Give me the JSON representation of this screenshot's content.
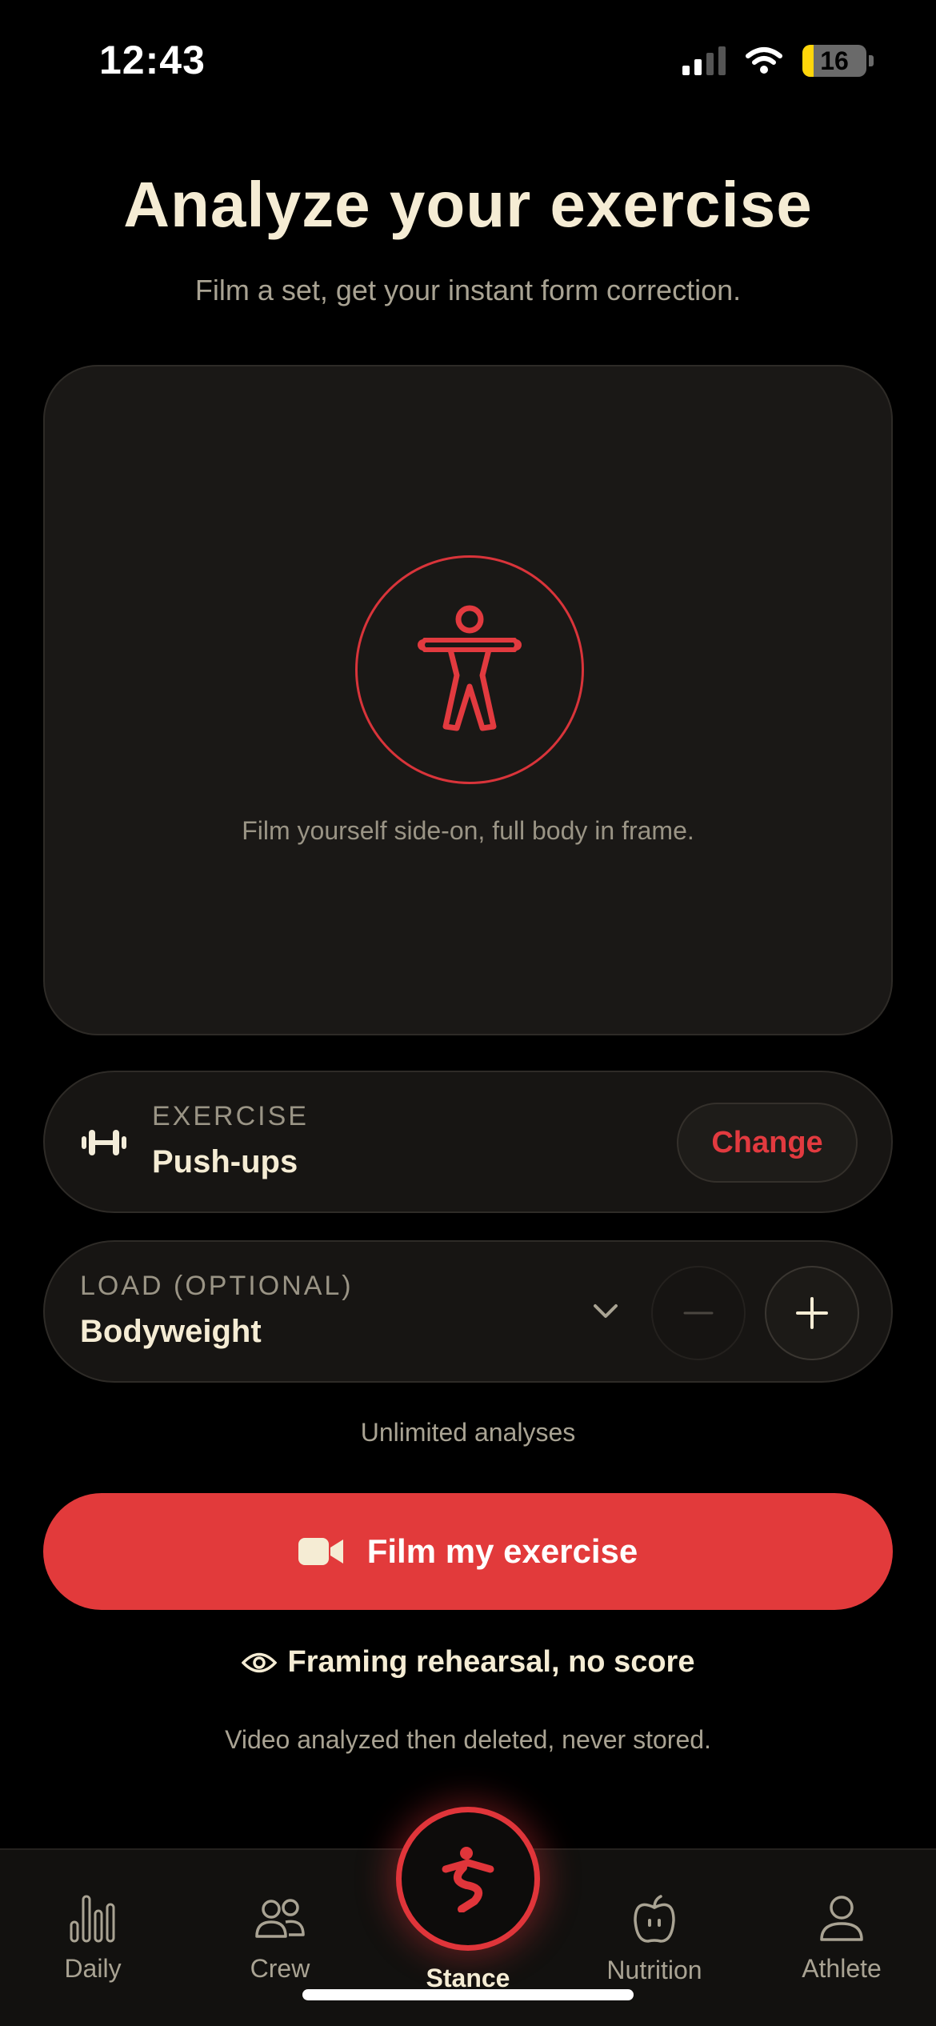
{
  "status_bar": {
    "time": "12:43",
    "battery": "16"
  },
  "header": {
    "title": "Analyze your exercise",
    "subtitle": "Film a set, get your instant form correction."
  },
  "camera": {
    "hint": "Film yourself side-on, full body in frame.",
    "icon": "body-figure-icon"
  },
  "exercise": {
    "label": "EXERCISE",
    "value": "Push-ups",
    "change_label": "Change",
    "icon": "dumbbell-icon"
  },
  "load": {
    "label": "LOAD (OPTIONAL)",
    "value": "Bodyweight"
  },
  "analyses_note": "Unlimited analyses",
  "film_button": {
    "label": "Film my exercise",
    "icon": "video-camera-icon"
  },
  "rehearsal": {
    "label": "Framing rehearsal, no score",
    "icon": "eye-icon"
  },
  "privacy_note": "Video analyzed then deleted, never stored.",
  "tabs": [
    {
      "label": "Daily",
      "icon": "bar-chart-icon"
    },
    {
      "label": "Crew",
      "icon": "people-icon"
    },
    {
      "label": "Stance",
      "icon": "stance-logo-icon"
    },
    {
      "label": "Nutrition",
      "icon": "apple-icon"
    },
    {
      "label": "Athlete",
      "icon": "person-icon"
    }
  ],
  "colors": {
    "accent": "#e23a3b",
    "background": "#000000",
    "card": "#171513",
    "text": "#f5ecd4",
    "muted": "#a9a393"
  }
}
